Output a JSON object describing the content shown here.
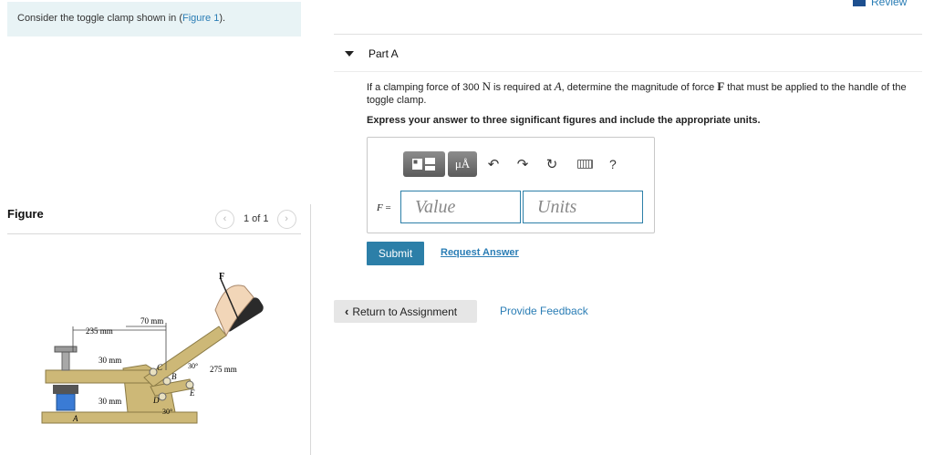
{
  "problem": {
    "text_before": "Consider the toggle clamp shown in (",
    "figure_link": "Figure 1",
    "text_after": ")."
  },
  "figure_panel": {
    "title": "Figure",
    "pager": "1 of 1",
    "prev_icon": "chevron-left-icon",
    "next_icon": "chevron-right-icon",
    "image_labels": {
      "force": "F",
      "dim_235": "235 mm",
      "dim_70": "70 mm",
      "dim_30_top": "30 mm",
      "dim_30_bottom": "30 mm",
      "dim_275": "275 mm",
      "angle_30_upper": "30°",
      "angle_30_lower": "30°",
      "point_a": "A",
      "point_b": "B",
      "point_c": "C",
      "point_d": "D",
      "point_e": "E"
    }
  },
  "review_link": "Review",
  "part": {
    "title": "Part A",
    "question": {
      "t1": "If a clamping force of 300",
      "unit_n": "N",
      "t2": "is required at",
      "point": "A",
      "t3": ", determine the magnitude of force",
      "force": "F",
      "t4": "that must be applied to the handle of the toggle clamp."
    },
    "instruction": "Express your answer to three significant figures and include the appropriate units."
  },
  "toolbar": {
    "templates_icon": "templates-icon",
    "mu_label": "μÅ",
    "undo_icon": "undo-icon",
    "redo_icon": "redo-icon",
    "reset_icon": "reset-icon",
    "keyboard_icon": "keyboard-icon",
    "help_label": "?"
  },
  "answer": {
    "var_label": "F",
    "eq": "=",
    "value_placeholder": "Value",
    "units_placeholder": "Units"
  },
  "actions": {
    "submit": "Submit",
    "request_answer": "Request Answer",
    "return": "Return to Assignment",
    "feedback": "Provide Feedback"
  },
  "colors": {
    "accent": "#2c7fa8",
    "link": "#2a7db5",
    "problem_bg": "#e8f3f5"
  }
}
